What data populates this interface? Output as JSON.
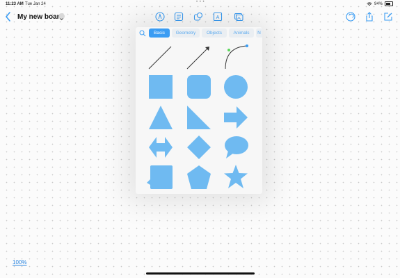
{
  "status_bar": {
    "time": "11:23 AM",
    "date": "Tue Jan 24",
    "battery": "94%"
  },
  "board": {
    "title": "My new board"
  },
  "toolbar": {
    "center_icons": [
      "pen-icon",
      "note-icon",
      "shapes-icon",
      "text-icon",
      "media-icon"
    ],
    "right_icons": [
      "undo-icon",
      "share-icon",
      "edit-icon"
    ]
  },
  "shapes_panel": {
    "tabs": [
      "Basic",
      "Geometry",
      "Objects",
      "Animals",
      "N"
    ],
    "active_tab": "Basic",
    "shapes": [
      "line",
      "arrow-line",
      "curve",
      "square",
      "rounded-square",
      "circle",
      "triangle",
      "right-triangle",
      "arrow",
      "double-arrow",
      "diamond",
      "speech-bubble",
      "callout-square",
      "pentagon",
      "star"
    ],
    "shape_color": "#6fbaf1"
  },
  "zoom": {
    "level": "100%"
  },
  "colors": {
    "accent": "#3a9cf3",
    "shape_fill": "#6fbaf1"
  }
}
